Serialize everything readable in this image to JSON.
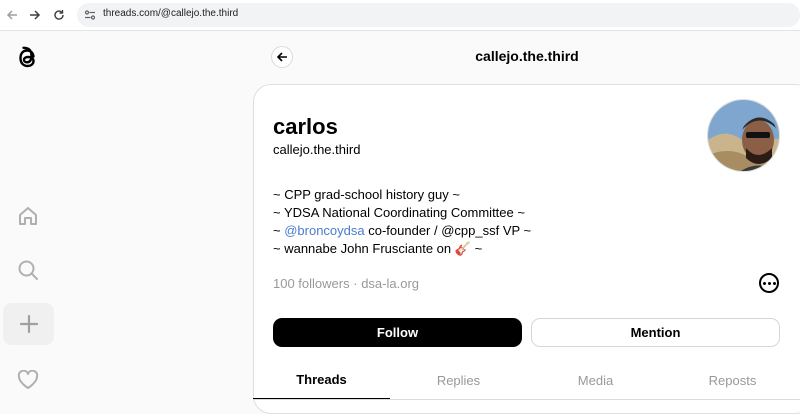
{
  "browser": {
    "url": "threads.com/@callejo.the.third"
  },
  "header": {
    "title": "callejo.the.third"
  },
  "profile": {
    "display_name": "carlos",
    "handle": "callejo.the.third",
    "bio": {
      "line1": "~ CPP grad-school history guy ~",
      "line2": "~ YDSA National Coordinating Committee ~",
      "line3_prefix": "~ ",
      "line3_link": "@broncoydsa",
      "line3_suffix": " co-founder / @cpp_ssf VP ~",
      "line4_prefix": "~ wannabe John Frusciante on ",
      "line4_emoji": "🎸",
      "line4_suffix": " ~"
    },
    "followers": "100 followers",
    "separator": "·",
    "website": "dsa-la.org"
  },
  "actions": {
    "follow_label": "Follow",
    "mention_label": "Mention"
  },
  "tabs": [
    {
      "label": "Threads",
      "active": true
    },
    {
      "label": "Replies",
      "active": false
    },
    {
      "label": "Media",
      "active": false
    },
    {
      "label": "Reposts",
      "active": false
    }
  ],
  "icons": {
    "logo": "threads-logo-icon",
    "home": "home-icon",
    "search": "search-icon",
    "create": "plus-icon",
    "activity": "heart-icon"
  }
}
